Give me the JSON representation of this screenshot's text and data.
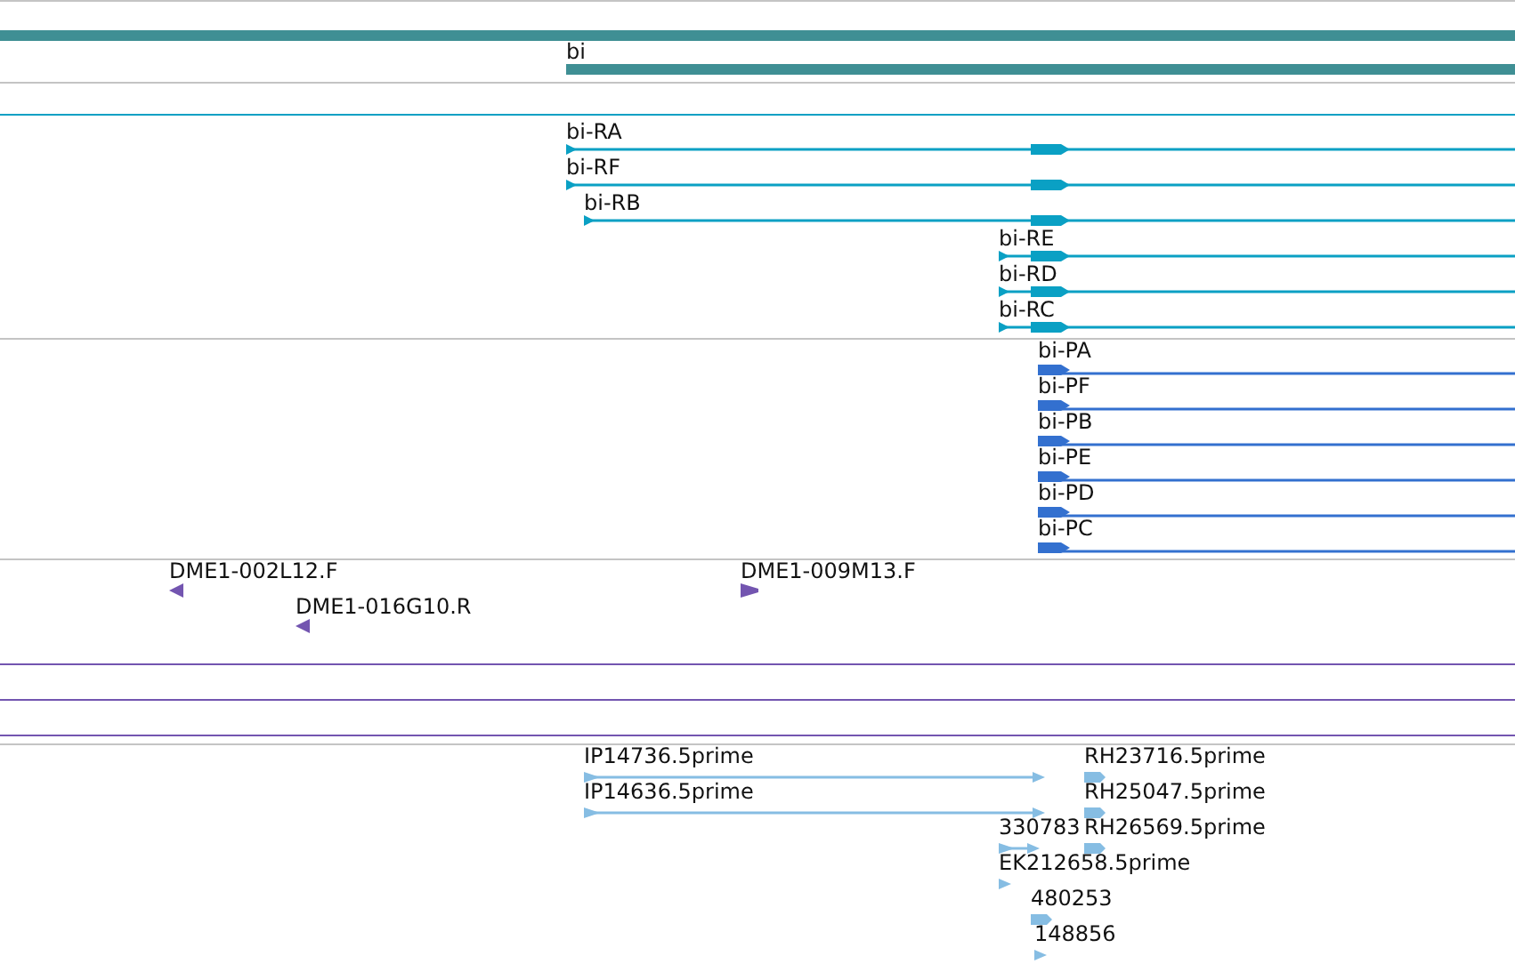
{
  "tracks": [
    {
      "kind": "gene",
      "features": [
        {
          "label": "bi"
        }
      ]
    },
    {
      "kind": "transcript",
      "features": [
        {
          "label": "bi-RA"
        },
        {
          "label": "bi-RF"
        },
        {
          "label": "bi-RB"
        },
        {
          "label": "bi-RE"
        },
        {
          "label": "bi-RD"
        },
        {
          "label": "bi-RC"
        }
      ]
    },
    {
      "kind": "protein",
      "features": [
        {
          "label": "bi-PA"
        },
        {
          "label": "bi-PF"
        },
        {
          "label": "bi-PB"
        },
        {
          "label": "bi-PE"
        },
        {
          "label": "bi-PD"
        },
        {
          "label": "bi-PC"
        }
      ]
    },
    {
      "kind": "marker",
      "features": [
        {
          "label": "DME1-002L12.F",
          "reverse": true
        },
        {
          "label": "DME1-016G10.R",
          "reverse": true
        },
        {
          "label": "DME1-009M13.F",
          "reverse": false
        }
      ]
    },
    {
      "kind": "est",
      "features": [
        {
          "label": "IP14736.5prime"
        },
        {
          "label": "RH23716.5prime"
        },
        {
          "label": "IP14636.5prime"
        },
        {
          "label": "RH25047.5prime"
        },
        {
          "label": "330783"
        },
        {
          "label": "RH26569.5prime"
        },
        {
          "label": "EK212658.5prime"
        },
        {
          "label": "480253"
        },
        {
          "label": "148856"
        }
      ]
    }
  ]
}
